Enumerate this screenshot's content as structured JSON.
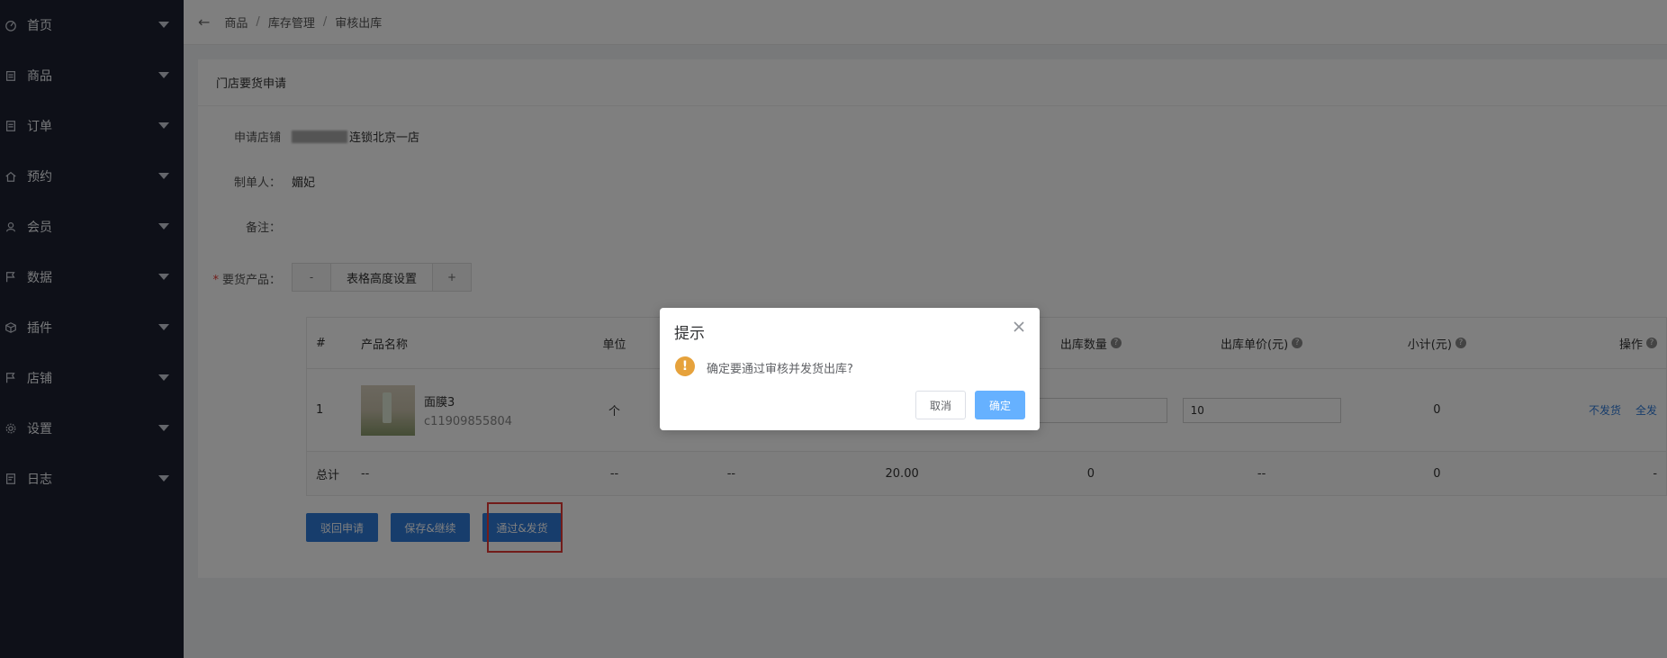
{
  "sidebar": {
    "items": [
      {
        "label": "首页",
        "icon": "dashboard-icon"
      },
      {
        "label": "商品",
        "icon": "goods-icon"
      },
      {
        "label": "订单",
        "icon": "order-icon"
      },
      {
        "label": "预约",
        "icon": "home-icon"
      },
      {
        "label": "会员",
        "icon": "member-icon"
      },
      {
        "label": "数据",
        "icon": "flag-icon"
      },
      {
        "label": "插件",
        "icon": "plugin-icon"
      },
      {
        "label": "店铺",
        "icon": "flag-icon"
      },
      {
        "label": "设置",
        "icon": "gear-icon"
      },
      {
        "label": "日志",
        "icon": "log-icon"
      }
    ]
  },
  "breadcrumb": {
    "items": [
      "商品",
      "库存管理",
      "审核出库"
    ],
    "sep": "/"
  },
  "card": {
    "title": "门店要货申请"
  },
  "form": {
    "store_label": "申请店铺",
    "store_value": "连锁北京一店",
    "maker_label": "制单人：",
    "maker_value": "媚妃",
    "note_label": "备注：",
    "products_label": "要货产品：",
    "required_mark": "*",
    "height_minus": "-",
    "height_label": "表格高度设置",
    "height_plus": "+"
  },
  "table": {
    "headers": {
      "idx": "#",
      "name": "产品名称",
      "unit": "单位",
      "out_qty": "出库数量",
      "out_price": "出库单价(元)",
      "subtotal": "小计(元)",
      "op": "操作"
    },
    "row": {
      "idx": "1",
      "name": "面膜3",
      "code": "c11909855804",
      "unit": "个",
      "price_input": "10",
      "subtotal": "0",
      "op_nosend": "不发货",
      "op_all": "全发"
    },
    "total": {
      "label": "总计",
      "name": "--",
      "unit": "--",
      "stock": "--",
      "req": "20.00",
      "out": "0",
      "price": "--",
      "sub": "0",
      "op": "-"
    }
  },
  "buttons": {
    "reject": "驳回申请",
    "save": "保存&继续",
    "approve": "通过&发货"
  },
  "dialog": {
    "title": "提示",
    "message": "确定要通过审核并发货出库?",
    "cancel": "取消",
    "confirm": "确定",
    "warn_glyph": "!"
  },
  "colors": {
    "sidebar_bg": "#1c2130",
    "primary": "#2f7ad8",
    "warning": "#e6a23c",
    "highlight": "#e53935"
  }
}
